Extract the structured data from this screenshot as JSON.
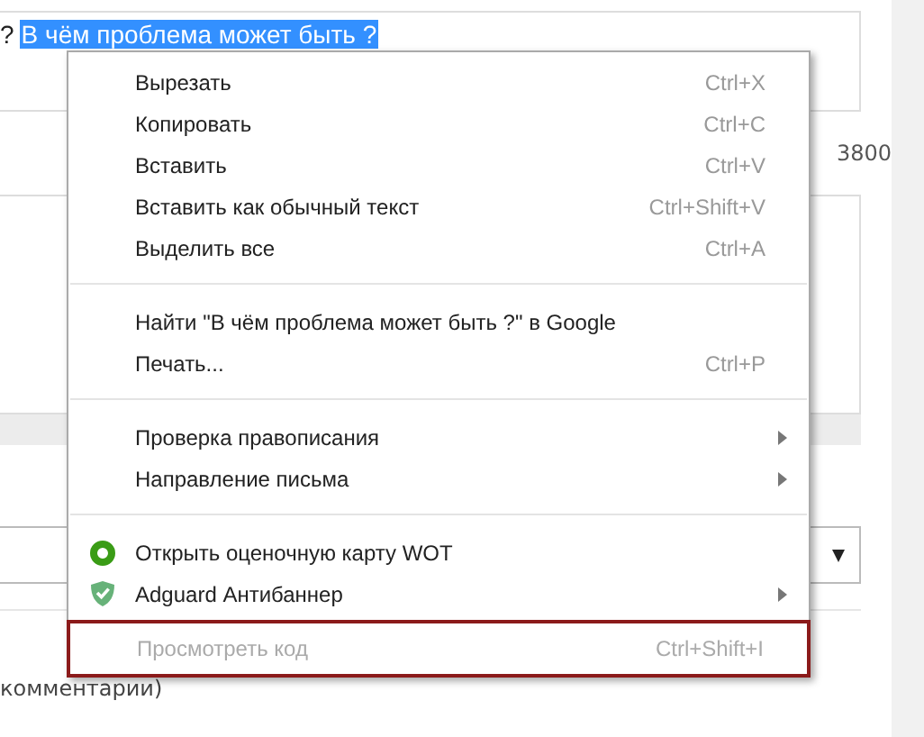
{
  "editor": {
    "prefix": "?",
    "selected_text": "В чём проблема может быть ?"
  },
  "counter": "3800",
  "comment_label": "комментарии)",
  "context_menu": {
    "items": [
      {
        "kind": "item",
        "label": "Вырезать",
        "shortcut": "Ctrl+X",
        "disabled": false,
        "highlighted": false
      },
      {
        "kind": "item",
        "label": "Копировать",
        "shortcut": "Ctrl+C",
        "disabled": false,
        "highlighted": false
      },
      {
        "kind": "item",
        "label": "Вставить",
        "shortcut": "Ctrl+V",
        "disabled": false,
        "highlighted": false
      },
      {
        "kind": "item",
        "label": "Вставить как обычный текст",
        "shortcut": "Ctrl+Shift+V",
        "disabled": false,
        "highlighted": false
      },
      {
        "kind": "item",
        "label": "Выделить все",
        "shortcut": "Ctrl+A",
        "disabled": false,
        "highlighted": false
      },
      {
        "kind": "separator"
      },
      {
        "kind": "item",
        "label": "Найти \"В чём проблема может быть ?\" в Google",
        "disabled": false,
        "highlighted": false
      },
      {
        "kind": "item",
        "label": "Печать...",
        "shortcut": "Ctrl+P",
        "disabled": false,
        "highlighted": false
      },
      {
        "kind": "separator"
      },
      {
        "kind": "submenu",
        "label": "Проверка правописания",
        "disabled": false,
        "highlighted": false
      },
      {
        "kind": "submenu",
        "label": "Направление письма",
        "disabled": false,
        "highlighted": false
      },
      {
        "kind": "separator"
      },
      {
        "kind": "rating",
        "label": "Открыть оценочную карту WOT",
        "disabled": false,
        "highlighted": false
      },
      {
        "kind": "extension",
        "label": "Adguard Антибаннер",
        "disabled": false,
        "highlighted": false
      },
      {
        "kind": "item",
        "label": "Просмотреть код",
        "shortcut": "Ctrl+Shift+I",
        "disabled": true,
        "highlighted": true
      }
    ]
  }
}
